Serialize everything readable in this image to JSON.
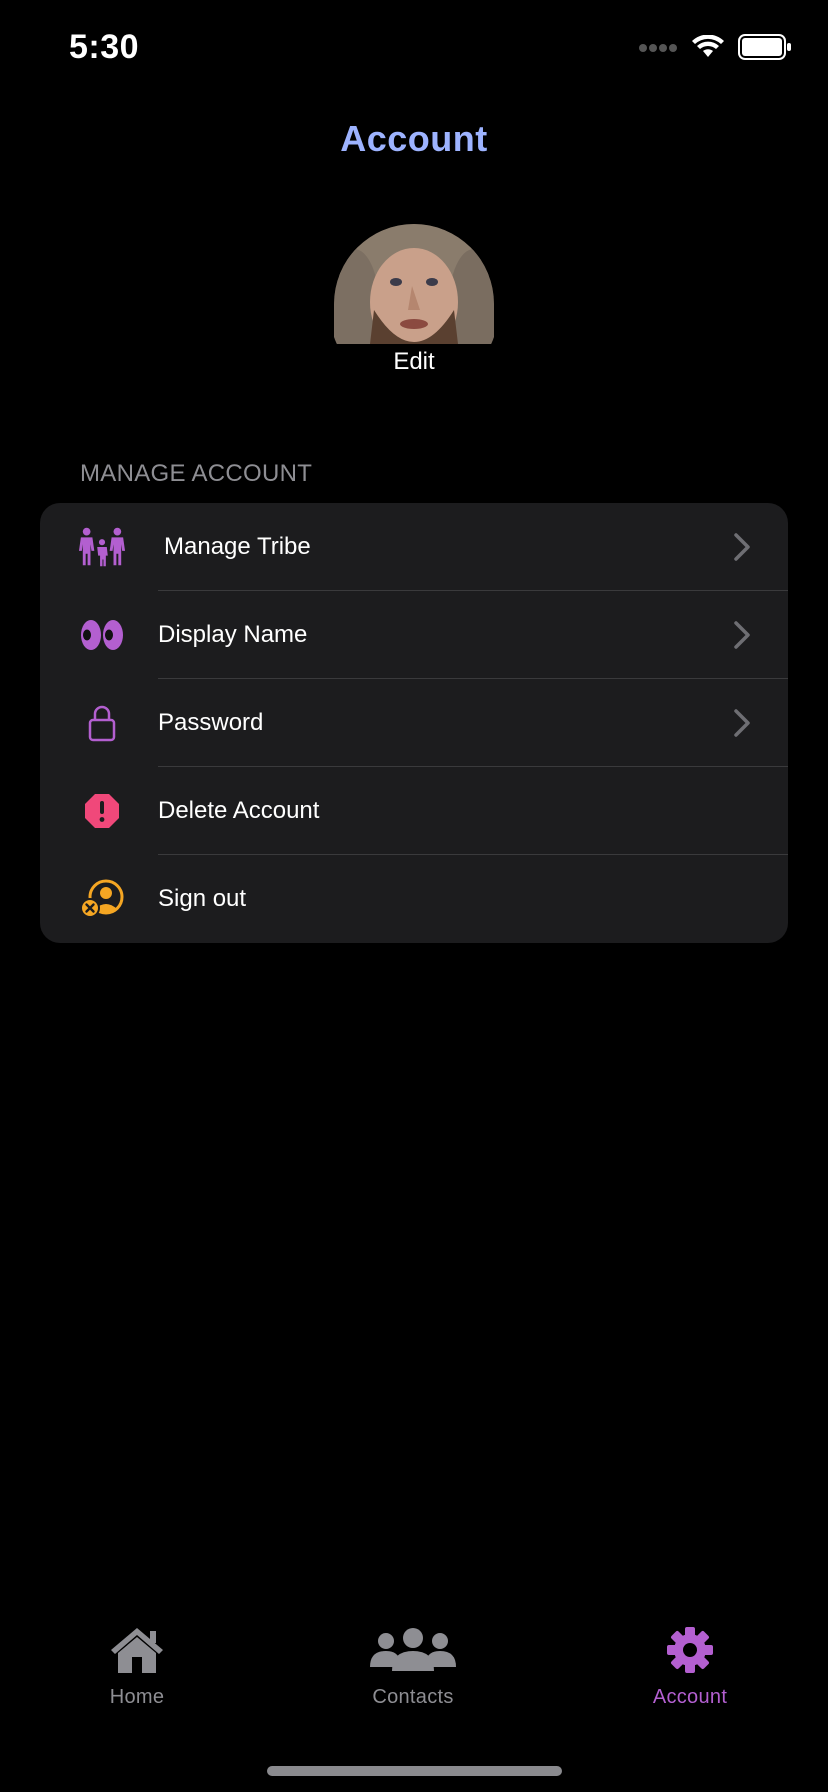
{
  "status_bar": {
    "time": "5:30"
  },
  "nav": {
    "title": "Account"
  },
  "profile": {
    "edit_label": "Edit"
  },
  "section": {
    "header": "MANAGE ACCOUNT"
  },
  "menu": {
    "items": [
      {
        "label": "Manage  Tribe",
        "icon": "family-icon",
        "has_chevron": true
      },
      {
        "label": "Display Name",
        "icon": "eyes-icon",
        "has_chevron": true
      },
      {
        "label": "Password",
        "icon": "lock-icon",
        "has_chevron": true
      },
      {
        "label": "Delete Account",
        "icon": "warning-octagon-icon",
        "has_chevron": false
      },
      {
        "label": "Sign out",
        "icon": "sign-out-user-icon",
        "has_chevron": false
      }
    ]
  },
  "tab_bar": {
    "tabs": [
      {
        "label": "Home",
        "icon": "house-icon",
        "selected": false
      },
      {
        "label": "Contacts",
        "icon": "people-icon",
        "selected": false
      },
      {
        "label": "Account",
        "icon": "gear-icon",
        "selected": true
      }
    ]
  },
  "colors": {
    "title_blue": "#9db3ff",
    "accent_purple": "#b35fd0",
    "danger_pink": "#f0487a",
    "signout_orange": "#f5a623",
    "tab_inactive": "#8e8e93",
    "row_bg": "#1c1c1e"
  }
}
